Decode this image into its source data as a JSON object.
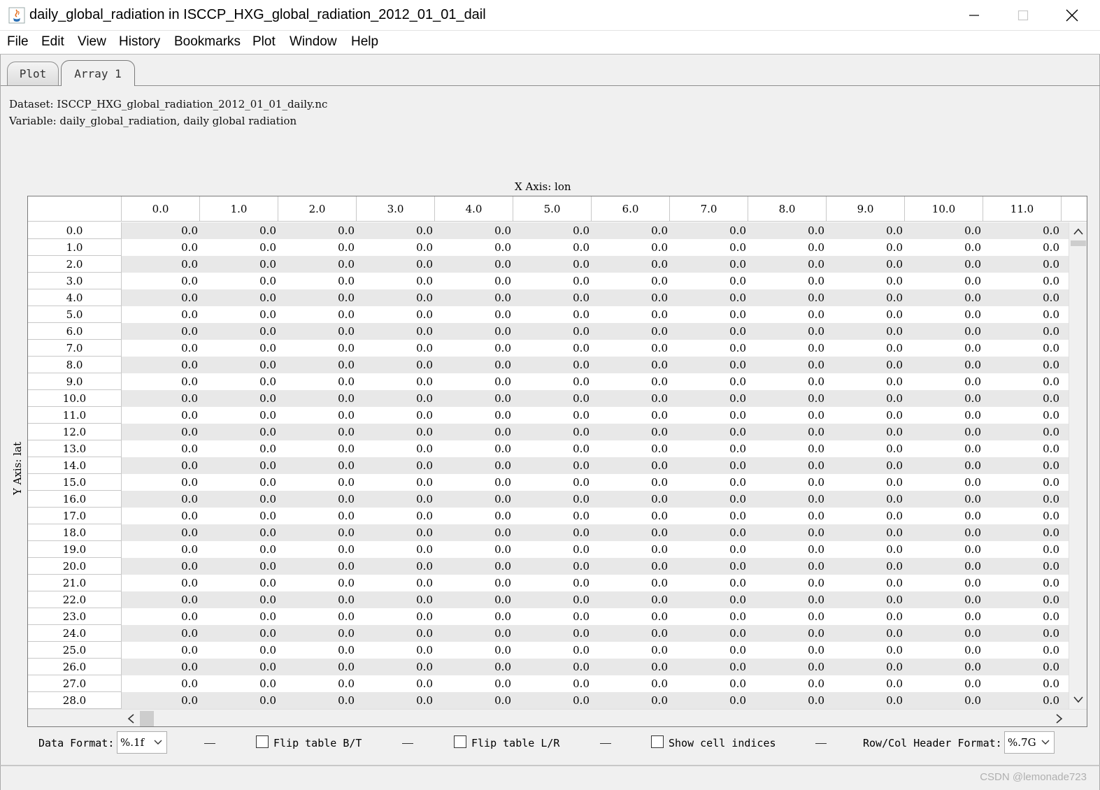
{
  "window": {
    "title": "daily_global_radiation in ISCCP_HXG_global_radiation_2012_01_01_dail"
  },
  "menu": [
    "File",
    "Edit",
    "View",
    "History",
    "Bookmarks",
    "Plot",
    "Window",
    "Help"
  ],
  "tabs": [
    {
      "label": "Plot",
      "active": false
    },
    {
      "label": "Array 1",
      "active": true
    }
  ],
  "info": {
    "dataset": "Dataset: ISCCP_HXG_global_radiation_2012_01_01_daily.nc",
    "variable": "Variable: daily_global_radiation, daily global radiation"
  },
  "table": {
    "x_axis_label": "X Axis: lon",
    "y_axis_label": "Y Axis: lat",
    "column_headers": [
      "0.0",
      "1.0",
      "2.0",
      "3.0",
      "4.0",
      "5.0",
      "6.0",
      "7.0",
      "8.0",
      "9.0",
      "10.0",
      "11.0"
    ],
    "row_headers": [
      "0.0",
      "1.0",
      "2.0",
      "3.0",
      "4.0",
      "5.0",
      "6.0",
      "7.0",
      "8.0",
      "9.0",
      "10.0",
      "11.0",
      "12.0",
      "13.0",
      "14.0",
      "15.0",
      "16.0",
      "17.0",
      "18.0",
      "19.0",
      "20.0",
      "21.0",
      "22.0",
      "23.0",
      "24.0",
      "25.0",
      "26.0",
      "27.0",
      "28.0"
    ],
    "cell_value": "0.0"
  },
  "controls": {
    "data_format_label": "Data Format:",
    "data_format_value": "%.1f",
    "flip_bt_label": "Flip table B/T",
    "flip_bt_checked": false,
    "flip_lr_label": "Flip table L/R",
    "flip_lr_checked": false,
    "show_indices_label": "Show cell indices",
    "show_indices_checked": false,
    "header_format_label": "Row/Col Header Format:",
    "header_format_value": "%.7G"
  },
  "watermark": "CSDN @lemonade723",
  "colors": {
    "row_stripe": "#e8e8e8",
    "grid": "#c8c8c8"
  }
}
